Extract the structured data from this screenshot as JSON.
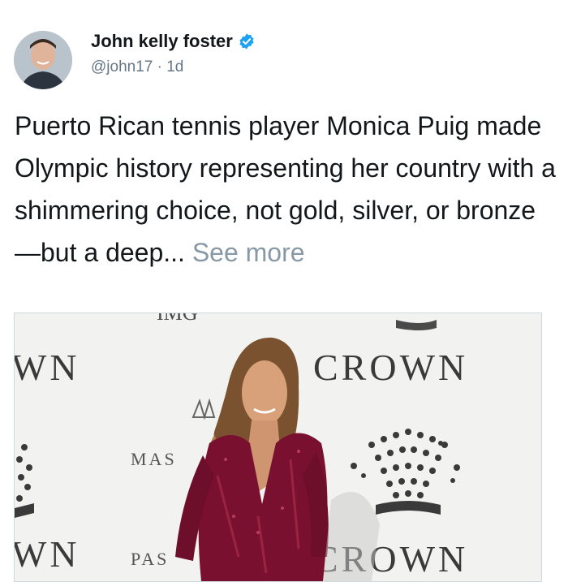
{
  "tweet": {
    "author_name": "John kelly foster",
    "handle": "@john17",
    "separator": "·",
    "age": "1d",
    "text": "Puerto Rican tennis player Monica Puig made Olympic history representing her country with a shimmering choice, not gold, silver, or bronze—but a deep...",
    "see_more": "See more"
  },
  "media": {
    "backdrop_texts": {
      "crown_upper": "CROWN",
      "crown_lower": "CROWN",
      "wn_upper": "WN",
      "wn_lower": "WN",
      "mas": "MAS",
      "pas": "PAS",
      "img_top": "IMG"
    }
  },
  "colors": {
    "verified_badge": "#1da1f2",
    "text": "#14171a",
    "secondary": "#657786",
    "see_more": "#8899a6",
    "dress": "#7a1030"
  },
  "icons": {
    "verified": "verified-badge-icon"
  }
}
